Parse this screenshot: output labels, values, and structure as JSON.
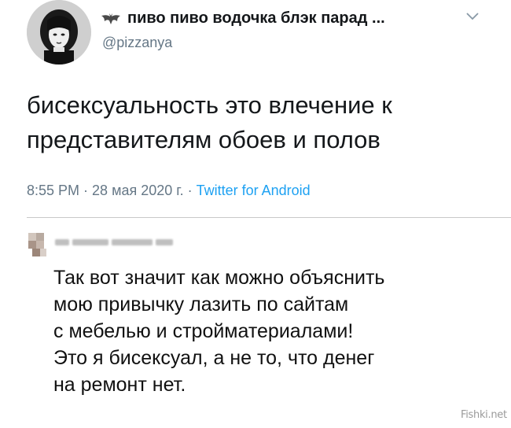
{
  "tweet": {
    "display_name": "пиво пиво водочка блэк парад ...",
    "handle": "@pizzanya",
    "text_lines": [
      "бисексуальность это влечение к",
      "представителям обоев и полов"
    ],
    "time": "8:55 PM",
    "separator": "·",
    "date": "28 мая 2020 г.",
    "source": "Twitter for Android"
  },
  "comment": {
    "text_lines": [
      "Так вот значит как можно объяснить",
      "мою привычку лазить по сайтам",
      "с мебелью и стройматериалами!",
      "Это я бисексуал, а не то, что денег",
      "на ремонт нет."
    ]
  },
  "watermark": "Fishki.net",
  "icons": {
    "bat": "bat-icon",
    "chevron": "chevron-down-icon"
  },
  "colors": {
    "text": "#14171a",
    "secondary": "#657786",
    "link": "#1da1f2"
  }
}
